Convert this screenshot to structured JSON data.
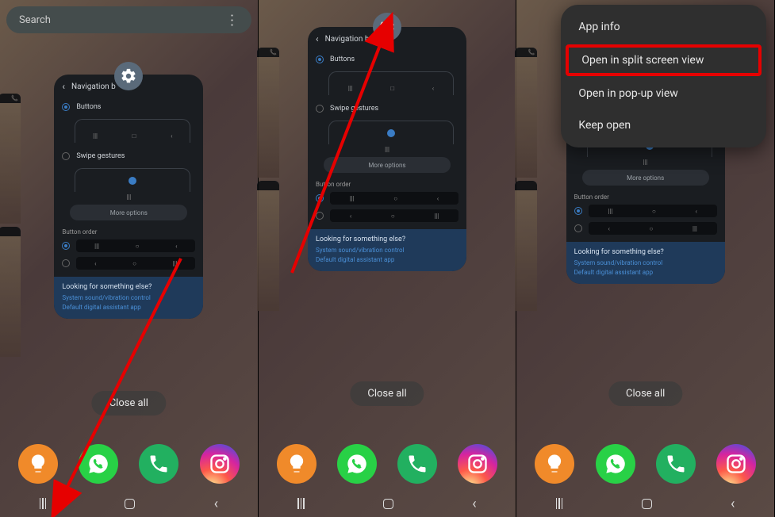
{
  "search": {
    "placeholder": "Search"
  },
  "card": {
    "title": "Navigation b",
    "title2": "Navigation b...",
    "opt_buttons": "Buttons",
    "opt_swipe": "Swipe gestures",
    "more_options": "More options",
    "button_order": "Button order",
    "footer_title": "Looking for something else?",
    "footer_link1": "System sound/vibration control",
    "footer_link2": "Default digital assistant app"
  },
  "close_all": "Close all",
  "popup": {
    "app_info": "App info",
    "split": "Open in split screen view",
    "popv": "Open in pop-up view",
    "keep": "Keep open"
  },
  "nav_glyphs": {
    "recent": "|||",
    "home": "○",
    "back": "‹"
  },
  "preview_glyphs": {
    "recent": "|||",
    "home": "□",
    "back": "‹"
  }
}
